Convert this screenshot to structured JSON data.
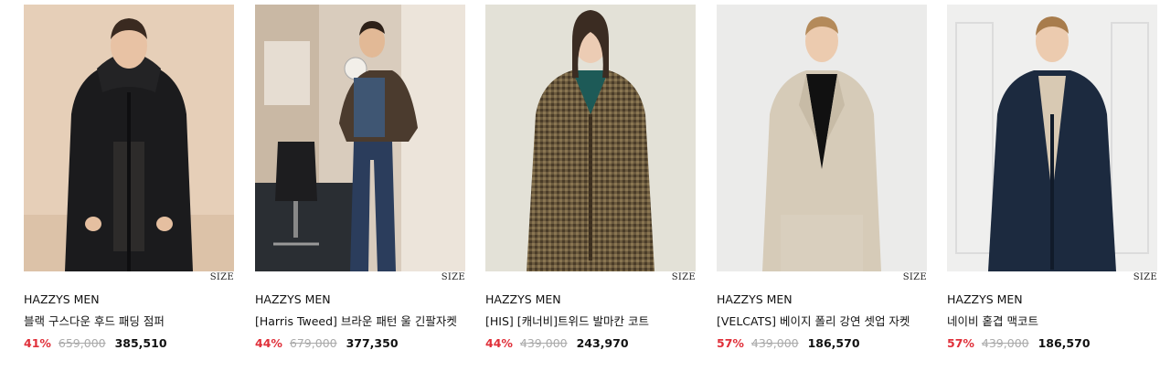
{
  "size_label": "SIZE",
  "products": [
    {
      "brand": "HAZZYS MEN",
      "name": "블랙 구스다운 후드 패딩 점퍼",
      "discount": "41%",
      "original_price": "659,000",
      "sale_price": "385,510",
      "image": "model-black-hooded-down-jacket"
    },
    {
      "brand": "HAZZYS MEN",
      "name": "[Harris Tweed] 브라운 패턴 울 긴팔자켓",
      "discount": "44%",
      "original_price": "679,000",
      "sale_price": "377,350",
      "image": "model-brown-tweed-jacket-office"
    },
    {
      "brand": "HAZZYS MEN",
      "name": "[HIS] [캐너비]트위드 발마칸 코트",
      "discount": "44%",
      "original_price": "439,000",
      "sale_price": "243,970",
      "image": "model-houndstooth-balmacaan-coat"
    },
    {
      "brand": "HAZZYS MEN",
      "name": "[VELCATS] 베이지 폴리 강연 셋업 자켓",
      "discount": "57%",
      "original_price": "439,000",
      "sale_price": "186,570",
      "image": "model-beige-setup-jacket"
    },
    {
      "brand": "HAZZYS MEN",
      "name": "네이비 홑겹 맥코트",
      "discount": "57%",
      "original_price": "439,000",
      "sale_price": "186,570",
      "image": "model-navy-mac-coat"
    }
  ],
  "colors": {
    "discount": "#e0303a",
    "original": "#aaaaaa",
    "text": "#111111"
  }
}
